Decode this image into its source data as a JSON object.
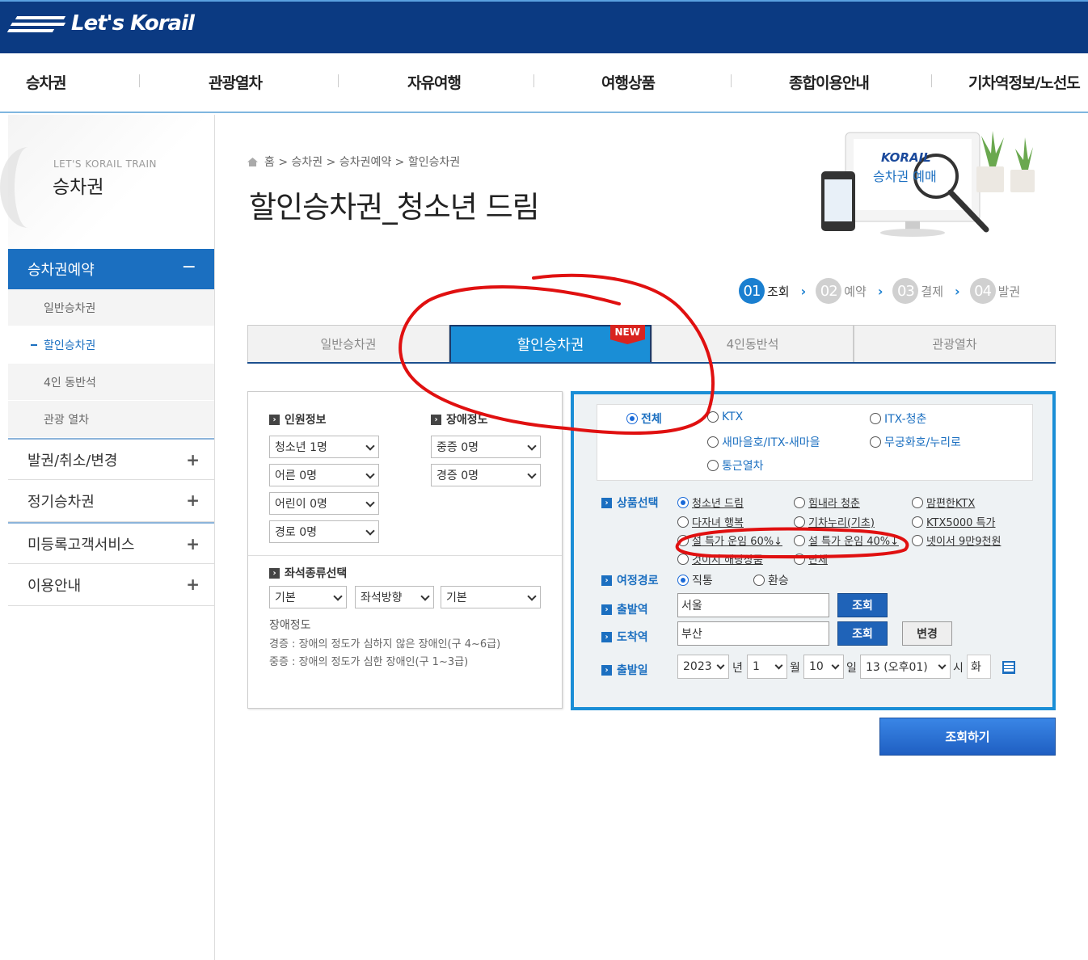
{
  "header": {
    "logo_text": "Let's Korail"
  },
  "gnb": [
    "승차권",
    "관광열차",
    "자유여행",
    "여행상품",
    "종합이용안내",
    "기차역정보/노선도"
  ],
  "lnb": {
    "sub_title": "LET'S KORAIL TRAIN",
    "title": "승차권",
    "active": {
      "label": "승차권예약",
      "sign": "−"
    },
    "children": [
      "일반승차권",
      "할인승차권",
      "4인 동반석",
      "관광 열차"
    ],
    "items": [
      "발권/취소/변경",
      "정기승차권",
      "미등록고객서비스",
      "이용안내"
    ]
  },
  "breadcrumb": [
    "홈",
    "승차권",
    "승차권예약",
    "할인승차권"
  ],
  "page_title": "할인승차권_청소년 드림",
  "hero": {
    "brand": "KORAIL",
    "caption": "승차권 예매"
  },
  "steps": [
    {
      "num": "01",
      "label": "조회"
    },
    {
      "num": "02",
      "label": "예약"
    },
    {
      "num": "03",
      "label": "결제"
    },
    {
      "num": "04",
      "label": "발권"
    }
  ],
  "tabs": [
    "일반승차권",
    "할인승차권",
    "4인동반석",
    "관광열차"
  ],
  "new_badge": "NEW",
  "passengers": {
    "heading": "인원정보",
    "selects": [
      "청소년 1명",
      "어른 0명",
      "어린이 0명",
      "경로 0명"
    ]
  },
  "disability": {
    "heading": "장애정도",
    "selects": [
      "중증 0명",
      "경증 0명"
    ]
  },
  "seat": {
    "heading": "좌석종류선택",
    "selects": [
      "기본",
      "좌석방향",
      "기본"
    ]
  },
  "notes": {
    "title": "장애정도",
    "lines": [
      "경증 : 장애의 정도가 심하지 않은 장애인(구 4~6급)",
      "중증 : 장애의 정도가 심한 장애인(구 1~3급)"
    ]
  },
  "train_types": [
    "전체",
    "KTX",
    "ITX-청춘",
    "새마을호/ITX-새마을",
    "무궁화호/누리로",
    "통근열차"
  ],
  "product": {
    "label": "상품선택",
    "options": [
      "청소년 드림",
      "힘내라 청춘",
      "맘편한KTX",
      "다자녀 행복",
      "기차누리(기초)",
      "KTX5000 특가",
      "설 특가 운임 60%↓",
      "설 특가 운임 40%↓",
      "넷이서 9만9천원",
      "것이지 해당상품",
      "단체"
    ]
  },
  "route": {
    "label": "여정경로",
    "options": [
      "직통",
      "환승"
    ]
  },
  "departure": {
    "label": "출발역",
    "value": "서울",
    "button": "조회"
  },
  "arrival": {
    "label": "도착역",
    "value": "부산",
    "button": "조회",
    "swap": "변경"
  },
  "date": {
    "label": "출발일",
    "year": "2023",
    "year_unit": "년",
    "month": "1",
    "month_unit": "월",
    "day": "10",
    "day_unit": "일",
    "hour": "13 (오후01)",
    "hour_unit": "시",
    "weekday": "화"
  },
  "submit": "조회하기",
  "colors": {
    "brand_navy": "#0b3a82",
    "accent_blue": "#1a8ed6",
    "annotation_red": "#e01010"
  }
}
